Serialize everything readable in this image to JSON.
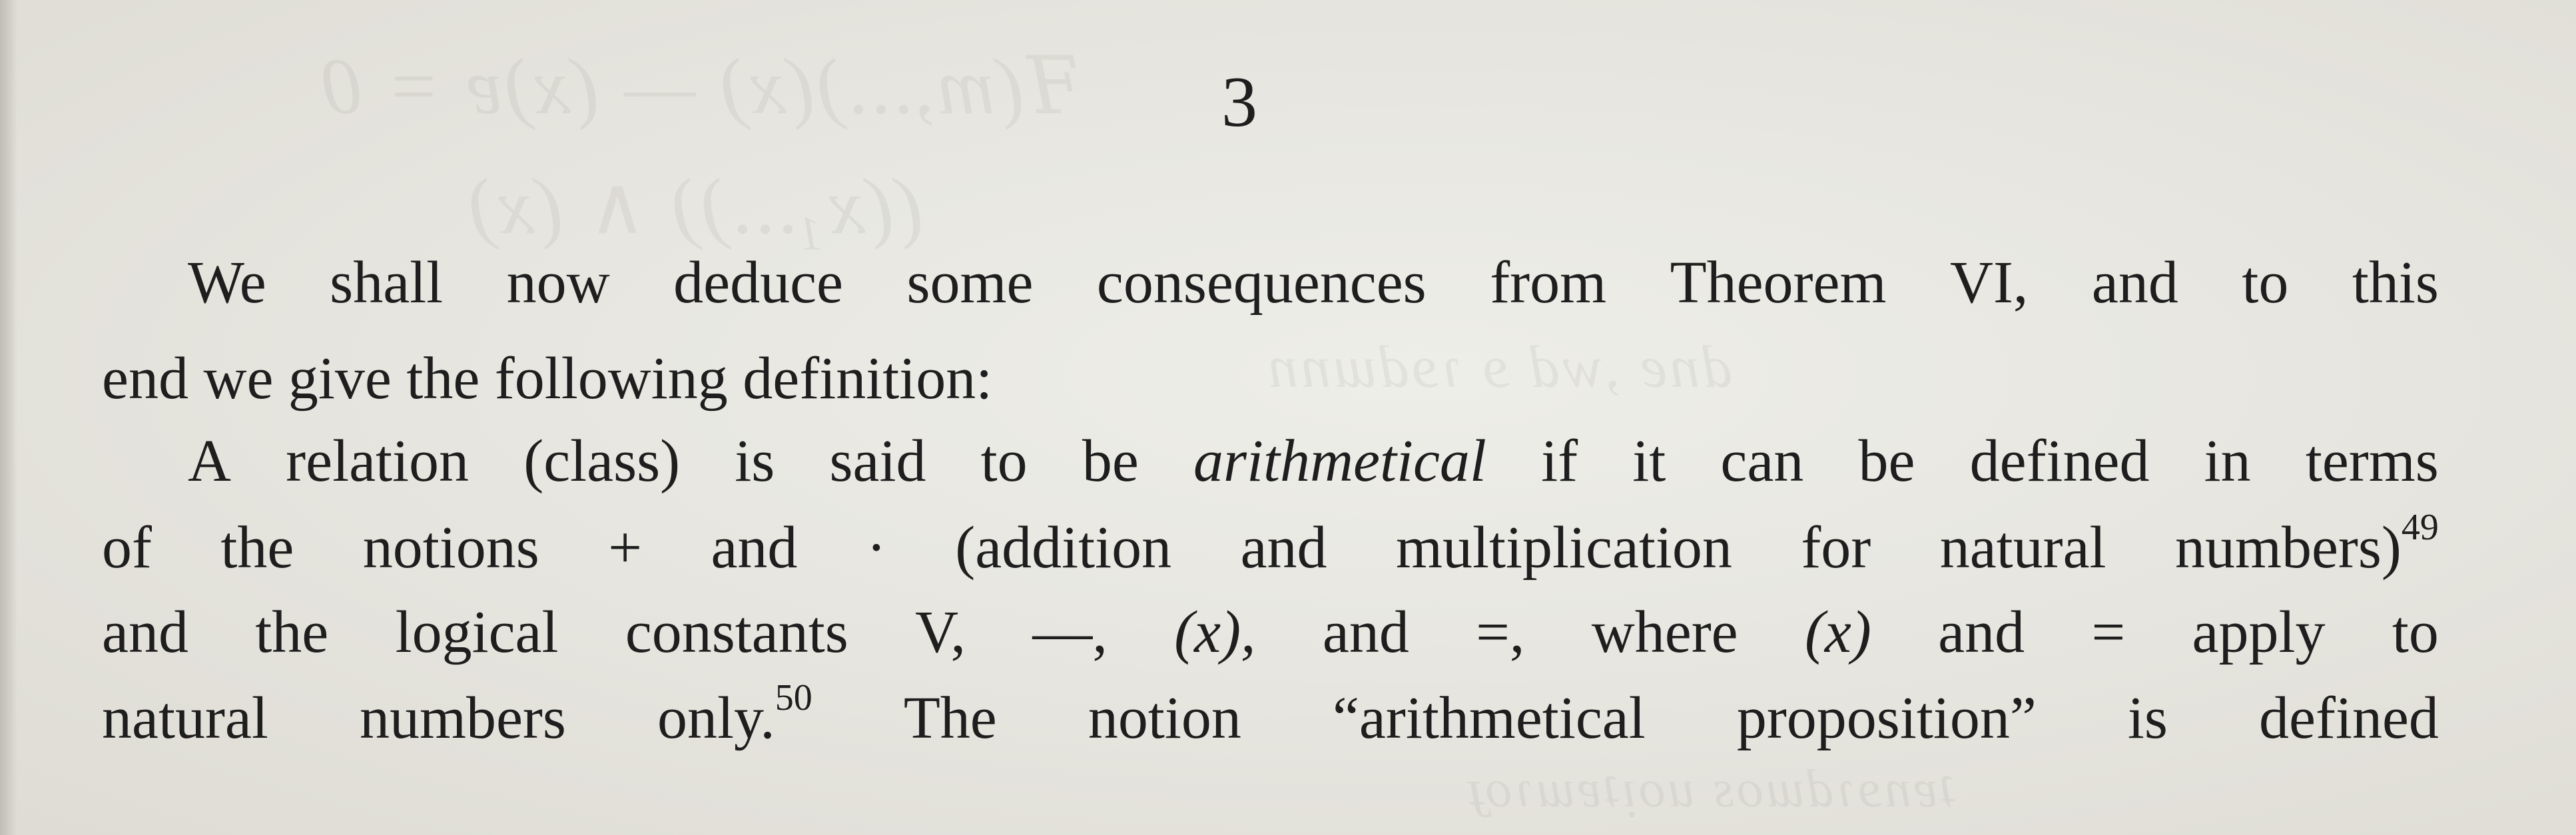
{
  "page": {
    "number": "3",
    "lines": [
      [
        "We",
        "shall",
        "now",
        "deduce",
        "some",
        "consequences",
        "from",
        "Theorem",
        "VI,",
        "and",
        "to",
        "this"
      ],
      [
        "end we give the following definition:"
      ],
      [
        "A",
        "relation",
        "(class)",
        "is",
        "said",
        "to",
        "be",
        "arithmetical",
        "if",
        "it",
        "can",
        "be",
        "defined",
        "in",
        "terms"
      ],
      [
        "of",
        "the",
        "notions",
        "+",
        "and",
        "·",
        "(addition",
        "and",
        "multiplication",
        "for",
        "natural",
        "numbers)",
        "49"
      ],
      [
        "and",
        "the",
        "logical",
        "constants",
        "V,",
        "—,",
        "(x),",
        "and",
        "=,",
        "where",
        "(x)",
        "and",
        "=",
        "apply",
        "to"
      ],
      [
        "natural",
        "numbers",
        "only.",
        "50",
        "The",
        "notion",
        "“arithmetical",
        "proposition”",
        "is",
        "defined"
      ]
    ],
    "italic_term": "arithmetical",
    "footnotes": [
      "49",
      "50"
    ]
  }
}
